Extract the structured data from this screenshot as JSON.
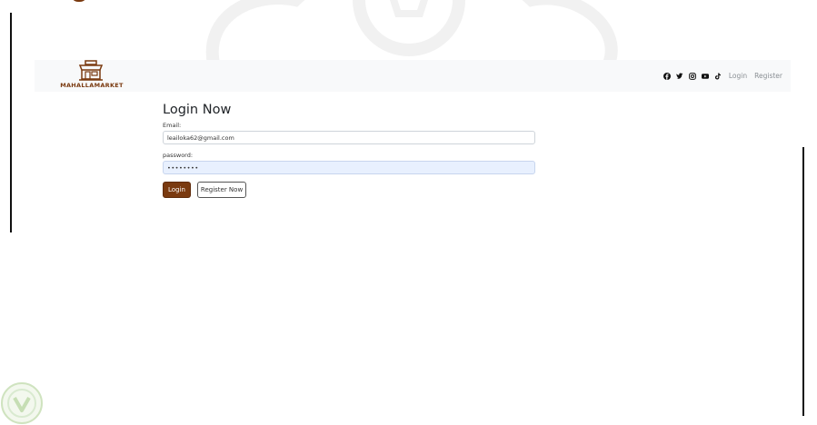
{
  "brand": {
    "name": "MAHALLAMARKET",
    "logo_icon": "storefront-icon",
    "color": "#7a3a10"
  },
  "nav": {
    "social_icons": [
      "facebook-icon",
      "twitter-icon",
      "instagram-icon",
      "youtube-icon",
      "tiktok-icon"
    ],
    "login_label": "Login",
    "register_label": "Register"
  },
  "form": {
    "title": "Login Now",
    "email_label": "Email:",
    "email_value": "leailoka62@gmail.com",
    "password_label": "password:",
    "password_value": "••••••••",
    "login_button": "Login",
    "register_button": "Register Now"
  },
  "colors": {
    "accent": "#7a3a10",
    "navbar_bg": "#f8f9fa",
    "autofill_bg": "#e8f0fe"
  }
}
